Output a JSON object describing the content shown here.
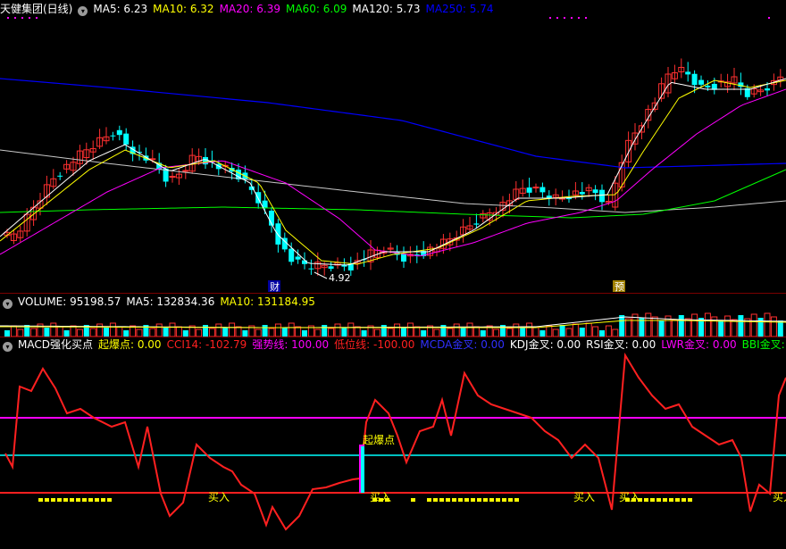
{
  "main_header": {
    "title": "天健集团(日线)",
    "items": [
      {
        "label": "MA5: 6.23",
        "color": "#ffffff"
      },
      {
        "label": "MA10: 6.32",
        "color": "#ffff00"
      },
      {
        "label": "MA20: 6.39",
        "color": "#ff00ff"
      },
      {
        "label": "MA60: 6.09",
        "color": "#00ff00"
      },
      {
        "label": "MA120: 5.73",
        "color": "#ffffff"
      },
      {
        "label": "MA250: 5.74",
        "color": "#0000ff"
      }
    ]
  },
  "annotations": {
    "low_price": "4.92",
    "cai_marker": "财",
    "yu_marker": "预",
    "qibao_label": "起爆点",
    "buy_labels": [
      "买入",
      "买入",
      "买入",
      "买入",
      "买入"
    ]
  },
  "volume_header": {
    "items": [
      {
        "label": "VOLUME: 95198.57",
        "color": "#ffffff"
      },
      {
        "label": "MA5: 132834.36",
        "color": "#ffffff"
      },
      {
        "label": "MA10: 131184.95",
        "color": "#ffff00"
      }
    ]
  },
  "indicator_header": {
    "title": "MACD强化买点",
    "items": [
      {
        "label": "起爆点: 0.00",
        "color": "#ffff00"
      },
      {
        "label": "CCI14: -102.79",
        "color": "#ff2020"
      },
      {
        "label": "强势线: 100.00",
        "color": "#ff00ff"
      },
      {
        "label": "低位线: -100.00",
        "color": "#ff2020"
      },
      {
        "label": "MCDA金叉: 0.00",
        "color": "#3030ff"
      },
      {
        "label": "KDJ金叉: 0.00",
        "color": "#ffffff"
      },
      {
        "label": "RSI金叉: 0.00",
        "color": "#ffffff"
      },
      {
        "label": "LWR金叉: 0.00",
        "color": "#ff00ff"
      },
      {
        "label": "BBI金叉: 0.00",
        "color": "#00ff00"
      }
    ]
  },
  "colors": {
    "up": "#ff3030",
    "down": "#00ffff",
    "ma5": "#ffffff",
    "ma10": "#ffff00",
    "ma20": "#ff00ff",
    "ma60": "#00ff00",
    "ma120": "#c8c8c8",
    "ma250": "#0000ff",
    "cci": "#ff2020",
    "strong": "#ff00ff",
    "mid": "#00ffff",
    "low": "#ff2020",
    "signal": "#ffff00"
  }
}
